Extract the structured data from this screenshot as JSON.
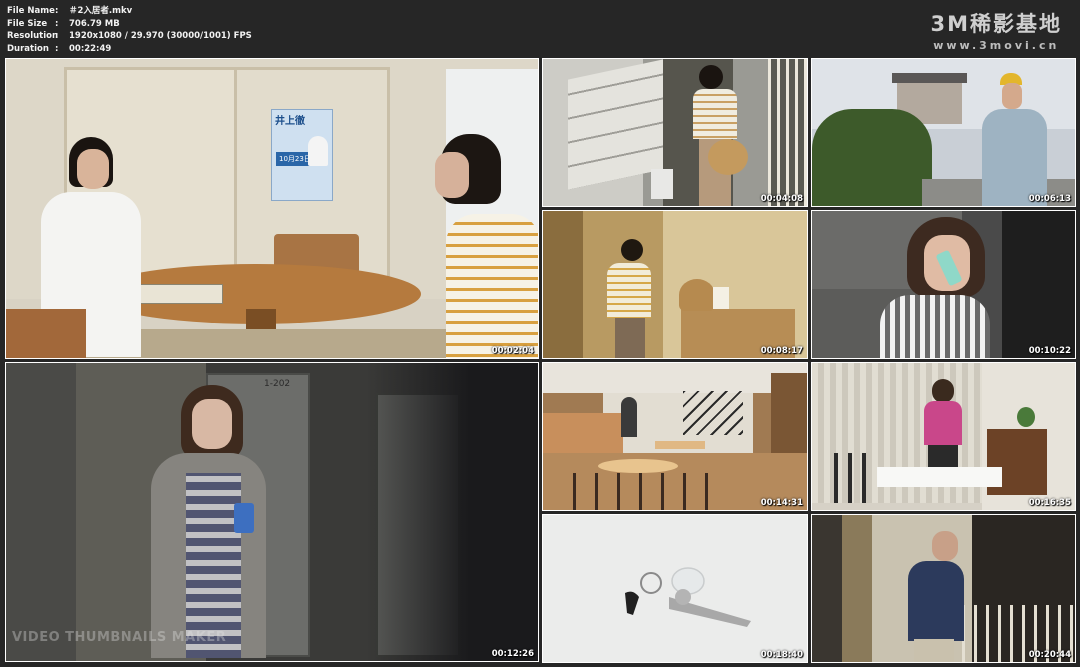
{
  "file_info": [
    {
      "key": "File Name",
      "sep": ":",
      "value": "＃2入居者.mkv"
    },
    {
      "key": "File Size",
      "sep": ":",
      "value": "706.79 MB"
    },
    {
      "key": "Resolution",
      "sep": ":",
      "value": "1920x1080 / 29.970 (30000/1001) FPS"
    },
    {
      "key": "Duration",
      "sep": ":",
      "value": "00:22:49"
    }
  ],
  "watermark": {
    "title": "3M稀影基地",
    "url": "www.3movi.cn"
  },
  "maker_label": "VIDEO THUMBNAILS MAKER",
  "poster_text": {
    "name": "井上徹",
    "date": "10月23日"
  },
  "door_number": "1-202",
  "thumbnails": [
    {
      "time": "00:02:04"
    },
    {
      "time": "00:04:08"
    },
    {
      "time": "00:06:13"
    },
    {
      "time": "00:08:17"
    },
    {
      "time": "00:10:22"
    },
    {
      "time": "00:12:26"
    },
    {
      "time": "00:14:31"
    },
    {
      "time": "00:16:35"
    },
    {
      "time": "00:18:40"
    },
    {
      "time": "00:20:44"
    }
  ]
}
